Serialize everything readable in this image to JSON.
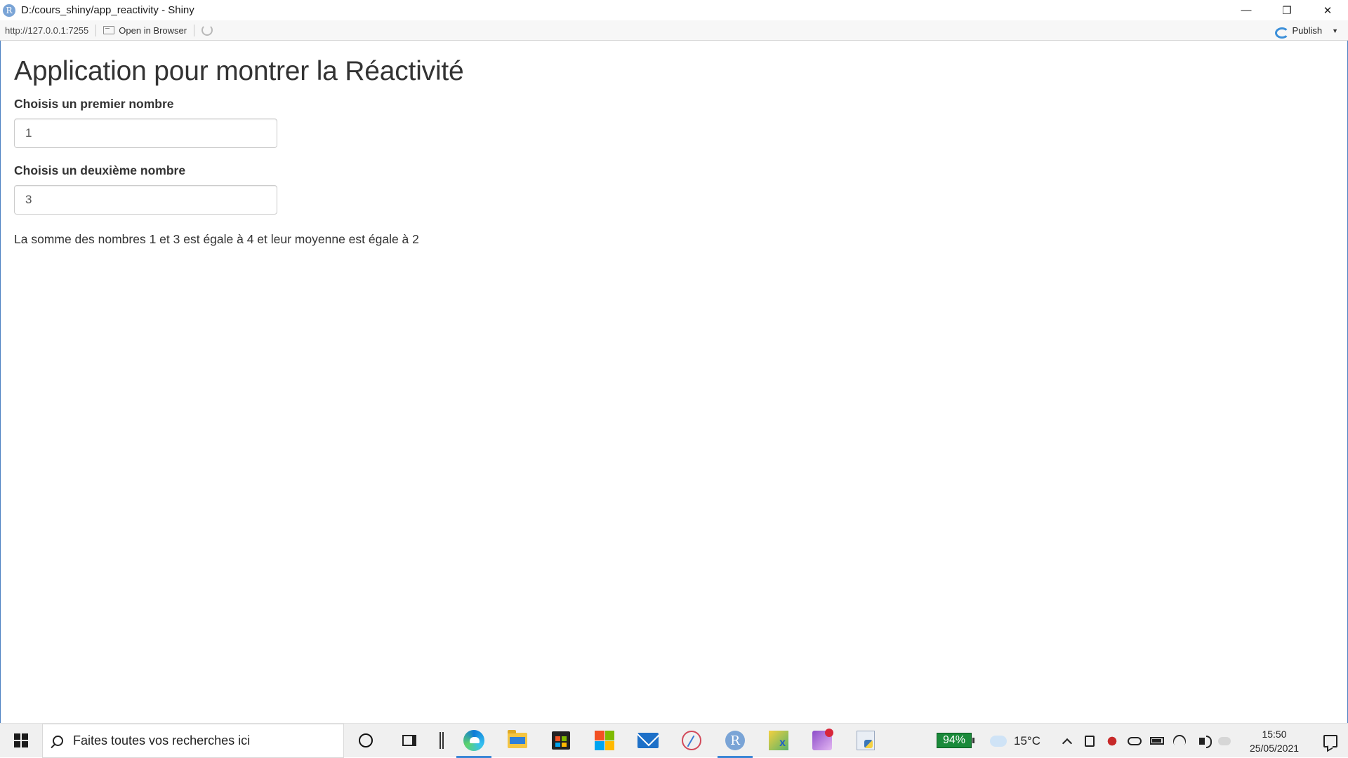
{
  "window": {
    "app_icon_letter": "R",
    "title": "D:/cours_shiny/app_reactivity - Shiny",
    "minimize": "—",
    "restore": "❐",
    "close": "✕"
  },
  "toolbar": {
    "url": "http://127.0.0.1:7255",
    "open_in_browser": "Open in Browser",
    "publish": "Publish"
  },
  "app": {
    "title": "Application pour montrer la Réactivité",
    "first_label": "Choisis un premier nombre",
    "first_value": "1",
    "second_label": "Choisis un deuxième nombre",
    "second_value": "3",
    "result": "La somme des nombres 1 et 3 est égale à 4 et leur moyenne est égale à 2"
  },
  "taskbar": {
    "search_placeholder": "Faites toutes vos recherches ici",
    "r_letter": "R",
    "battery_badge": "94%",
    "temperature": "15°C",
    "time": "15:50",
    "date": "25/05/2021",
    "pinned_icons": [
      "edge-icon",
      "file-explorer-icon",
      "microsoft-store-icon",
      "office-icon",
      "mail-icon",
      "snipping-tool-icon",
      "r-gui-icon",
      "app-icon",
      "paint-icon",
      "python-icon"
    ]
  }
}
